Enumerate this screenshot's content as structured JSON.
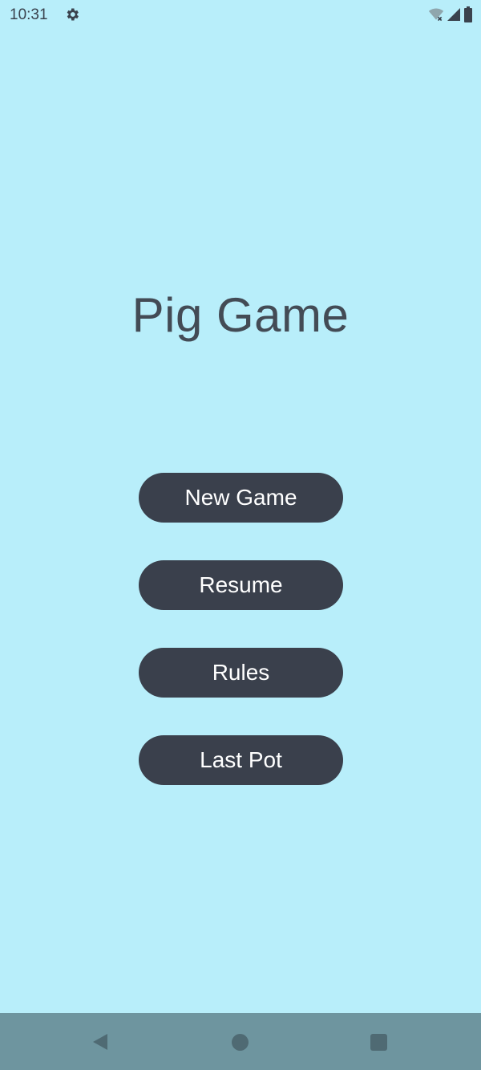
{
  "status_bar": {
    "time": "10:31",
    "icons": [
      "gear-icon",
      "wifi-icon",
      "signal-icon",
      "battery-icon"
    ]
  },
  "app": {
    "title": "Pig Game"
  },
  "menu": {
    "new_game": "New Game",
    "resume": "Resume",
    "rules": "Rules",
    "last_pot": "Last Pot"
  },
  "navigation": {
    "icons": [
      "back-icon",
      "home-icon",
      "recents-icon"
    ]
  },
  "colors": {
    "background": "#b8eefa",
    "button": "#3a404c",
    "title": "#434b55",
    "nav_bar": "#6e959f"
  }
}
